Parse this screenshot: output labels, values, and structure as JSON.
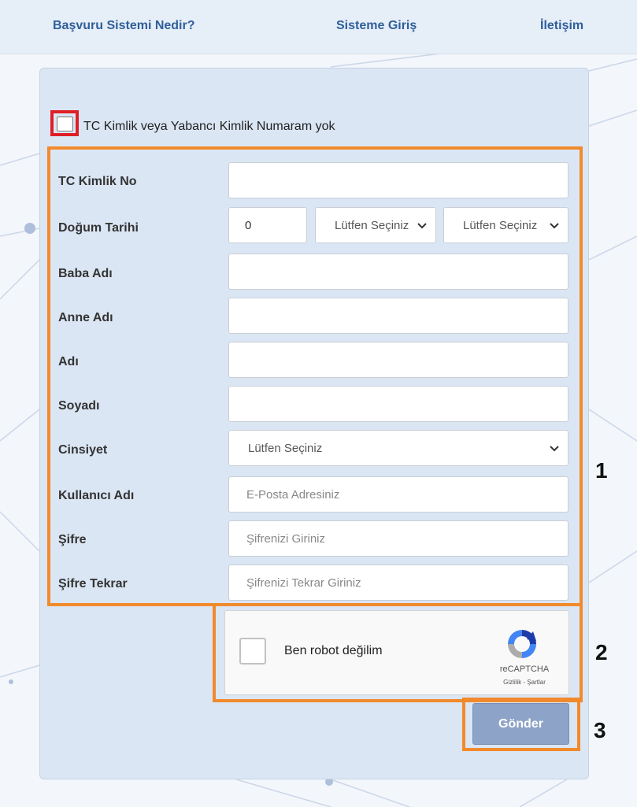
{
  "nav": {
    "items": [
      "Başvuru Sistemi Nedir?",
      "Sisteme Giriş",
      "İletişim"
    ]
  },
  "form": {
    "no_tc_label": "TC Kimlik veya Yabancı Kimlik Numaram yok",
    "tc_label": "TC Kimlik No",
    "dob_label": "Doğum Tarihi",
    "dob_day": "0",
    "dob_month": "Lütfen Seçiniz",
    "dob_year": "Lütfen Seçiniz",
    "father_label": "Baba Adı",
    "mother_label": "Anne Adı",
    "name_label": "Adı",
    "surname_label": "Soyadı",
    "gender_label": "Cinsiyet",
    "gender_value": "Lütfen Seçiniz",
    "username_label": "Kullanıcı Adı",
    "username_placeholder": "E-Posta Adresiniz",
    "password_label": "Şifre",
    "password_placeholder": "Şifrenizi Giriniz",
    "password2_label": "Şifre Tekrar",
    "password2_placeholder": "Şifrenizi Tekrar Giriniz"
  },
  "captcha": {
    "label": "Ben robot değilim",
    "brand": "reCAPTCHA",
    "links": "Gizlilik - Şartlar"
  },
  "submit_label": "Gönder",
  "annotations": [
    "1",
    "2",
    "3"
  ],
  "colors": {
    "highlight_red": "#e01e26",
    "highlight_orange": "#f28a2c",
    "nav_link": "#2f5f9a",
    "panel_bg": "#dbe6f4",
    "submit_bg": "#8ea3c8"
  },
  "icons": [
    "chevron-down-icon",
    "recaptcha-logo-icon"
  ]
}
